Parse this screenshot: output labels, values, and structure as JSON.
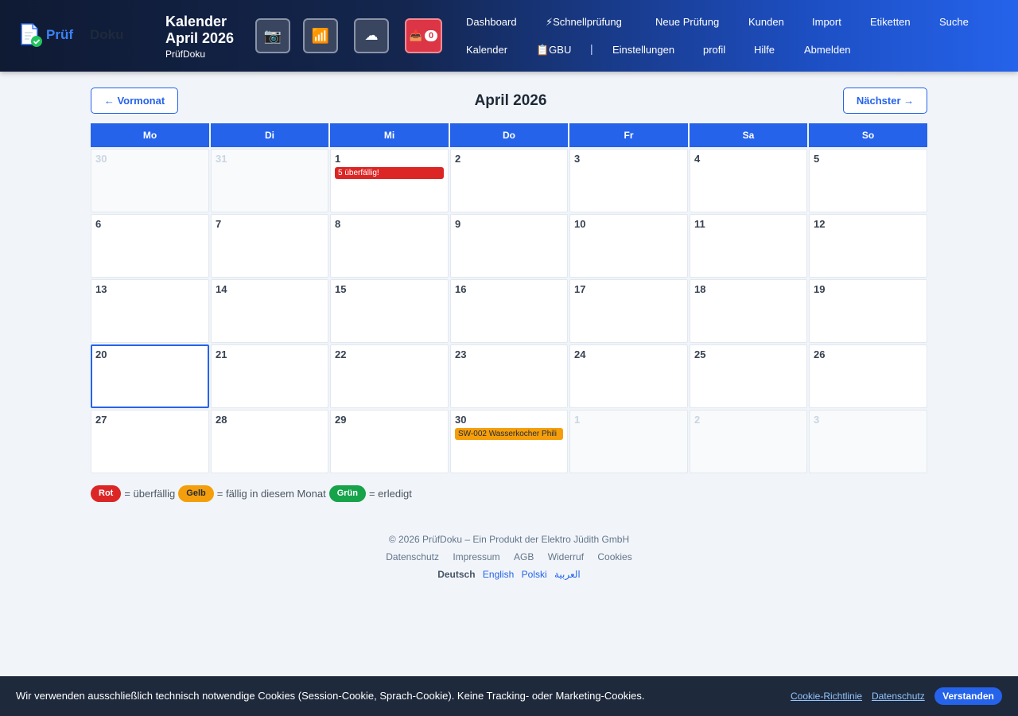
{
  "header": {
    "logo": {
      "part1": "Prüf",
      "part2": "Doku"
    },
    "title": "Kalender",
    "subtitle": "April 2026",
    "app_name": "PrüfDoku",
    "icons": {
      "camera": "camera-icon",
      "signal": "signal-icon",
      "cloud": "cloud-icon",
      "inbox": "inbox-icon"
    },
    "inbox_count": "0",
    "nav_row1": [
      "Dashboard",
      "⚡Schnellprüfung",
      "Neue Prüfung",
      "Kunden",
      "Import",
      "Etiketten",
      "Suche"
    ],
    "nav_row2": [
      "Kalender",
      "📋GBU",
      "Einstellungen",
      "profil",
      "Hilfe",
      "Abmelden"
    ],
    "separator": "|"
  },
  "calendar": {
    "prev_label": "← Vormonat",
    "next_label": "Nächster →",
    "month_title": "April 2026",
    "weekdays": [
      "Mo",
      "Di",
      "Mi",
      "Do",
      "Fr",
      "Sa",
      "So"
    ],
    "weeks": [
      [
        {
          "day": "30",
          "other": true
        },
        {
          "day": "31",
          "other": true
        },
        {
          "day": "1",
          "event": {
            "text": "5 überfällig!",
            "color": "red"
          }
        },
        {
          "day": "2"
        },
        {
          "day": "3"
        },
        {
          "day": "4"
        },
        {
          "day": "5"
        }
      ],
      [
        {
          "day": "6"
        },
        {
          "day": "7"
        },
        {
          "day": "8"
        },
        {
          "day": "9"
        },
        {
          "day": "10"
        },
        {
          "day": "11"
        },
        {
          "day": "12"
        }
      ],
      [
        {
          "day": "13"
        },
        {
          "day": "14"
        },
        {
          "day": "15"
        },
        {
          "day": "16"
        },
        {
          "day": "17"
        },
        {
          "day": "18"
        },
        {
          "day": "19"
        }
      ],
      [
        {
          "day": "20",
          "today": true
        },
        {
          "day": "21"
        },
        {
          "day": "22"
        },
        {
          "day": "23"
        },
        {
          "day": "24"
        },
        {
          "day": "25"
        },
        {
          "day": "26"
        }
      ],
      [
        {
          "day": "27"
        },
        {
          "day": "28"
        },
        {
          "day": "29"
        },
        {
          "day": "30",
          "event": {
            "text": "SW-002 Wasserkocher Phili",
            "color": "yellow"
          }
        },
        {
          "day": "1",
          "other": true
        },
        {
          "day": "2",
          "other": true
        },
        {
          "day": "3",
          "other": true
        }
      ]
    ]
  },
  "legend": {
    "red_label": "Rot",
    "red_text": "= überfällig",
    "yellow_label": "Gelb",
    "yellow_text": "= fällig in diesem Monat",
    "green_label": "Grün",
    "green_text": "= erledigt"
  },
  "footer": {
    "copyright": "© 2026 PrüfDoku – Ein Produkt der Elektro Jüdith GmbH",
    "links": [
      "Datenschutz",
      "Impressum",
      "AGB",
      "Widerruf",
      "Cookies"
    ],
    "languages": [
      "Deutsch",
      "English",
      "Polski",
      "العربية"
    ],
    "active_language": "Deutsch"
  },
  "cookie_banner": {
    "text": "Wir verwenden ausschließlich technisch notwendige Cookies (Session-Cookie, Sprach-Cookie). Keine Tracking- oder Marketing-Cookies.",
    "policy_link": "Cookie-Richtlinie",
    "privacy_link": "Datenschutz",
    "accept_label": "Verstanden"
  },
  "colors": {
    "primary": "#2563eb",
    "overdue": "#dc2626",
    "due": "#f59e0b",
    "done": "#16a34a"
  }
}
